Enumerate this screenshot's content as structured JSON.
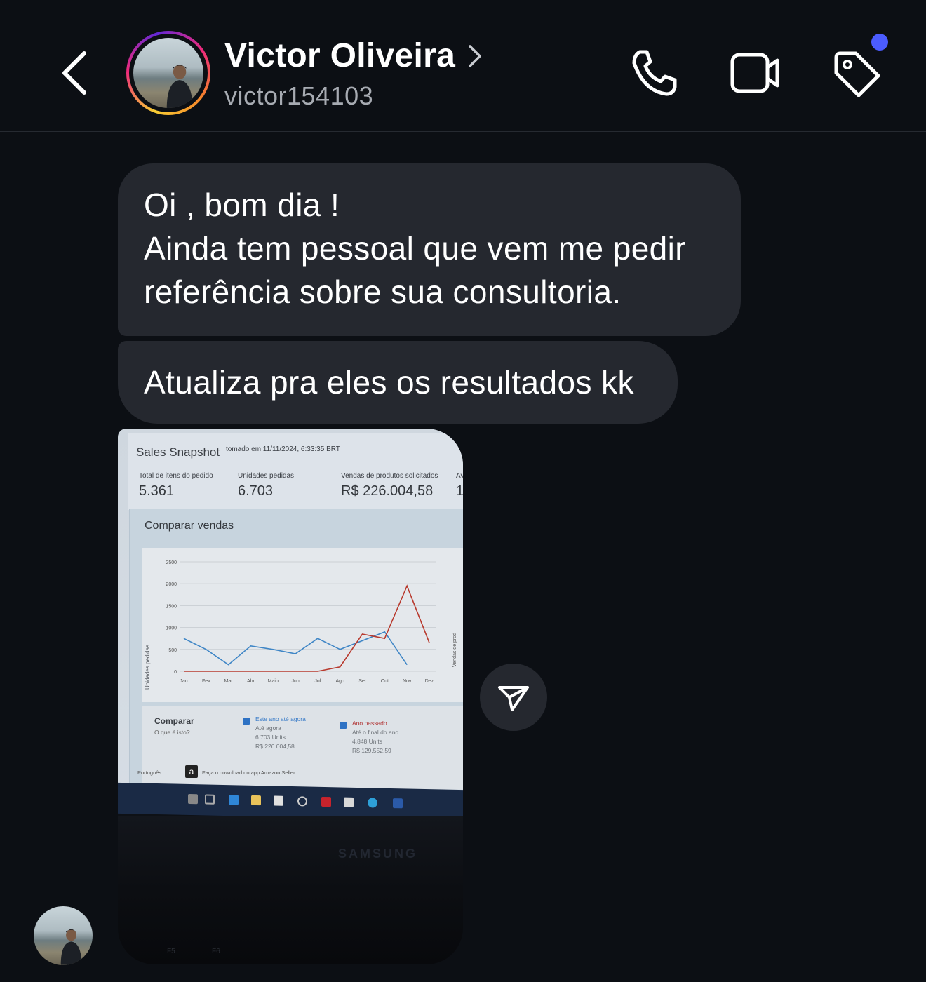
{
  "header": {
    "contact_name": "Victor Oliveira",
    "contact_handle": "victor154103",
    "icons": [
      "back-chevron-icon",
      "chevron-right-icon",
      "phone-icon",
      "video-camera-icon",
      "tag-icon"
    ],
    "notification_dot_color": "#4b5cff"
  },
  "messages": [
    {
      "type": "text",
      "lines": [
        "Oi , bom dia !",
        "Ainda tem pessoal que vem me pedir",
        "referência sobre sua consultoria."
      ]
    },
    {
      "type": "text",
      "lines": [
        "Atualiza pra eles os resultados kk"
      ]
    },
    {
      "type": "photo",
      "photo": {
        "title": "Sales Snapshot",
        "subtitle": "tomado em 11/11/2024, 6:33:35 BRT",
        "metrics": [
          {
            "label": "Total de itens do pedido",
            "value": "5.361"
          },
          {
            "label": "Unidades pedidas",
            "value": "6.703"
          },
          {
            "label": "Vendas de produtos solicitados",
            "value": "R$ 226.004,58"
          },
          {
            "label": "Av",
            "value": "1"
          }
        ],
        "compare_title": "Comparar vendas",
        "legend": {
          "heading": "Comparar",
          "subheading": "O que é isto?",
          "this_year": {
            "title": "Este ano até agora",
            "period": "Até agora",
            "units": "6.703 Units",
            "sales": "R$ 226.004,58"
          },
          "last_year": {
            "title": "Ano passado",
            "period": "Até o final do ano",
            "units": "4.848 Units",
            "sales": "R$ 129.552,59"
          }
        },
        "footer": {
          "language": "Português",
          "app_icon_letter": "a",
          "download_text": "Faça o download do app Amazon Seller"
        },
        "monitor_brand": "SAMSUNG",
        "keys": [
          "F5",
          "F6"
        ],
        "chart_data": {
          "type": "line",
          "ylabel": "Unidades pedidas",
          "y2label": "Vendas de prod",
          "ylim": [
            0,
            2500
          ],
          "y_ticks": [
            "2500",
            "2000",
            "1500",
            "1000",
            "500",
            "0"
          ],
          "categories": [
            "Jan",
            "Fev",
            "Mar",
            "Abr",
            "Maio",
            "Jun",
            "Jul",
            "Ago",
            "Set",
            "Out",
            "Nov",
            "Dez"
          ],
          "series": [
            {
              "color": "#3f86c6",
              "values": [
                750,
                500,
                150,
                580,
                500,
                400,
                750,
                500,
                700,
                900,
                150,
                null
              ]
            },
            {
              "color": "#b83a2e",
              "values": [
                0,
                0,
                0,
                0,
                0,
                0,
                0,
                100,
                850,
                750,
                1950,
                650
              ]
            }
          ]
        }
      }
    }
  ],
  "share_button": {
    "icon": "send-icon"
  },
  "colors": {
    "background": "#0c0f14",
    "bubble": "#25282f",
    "handle_text": "#a7abb2"
  }
}
